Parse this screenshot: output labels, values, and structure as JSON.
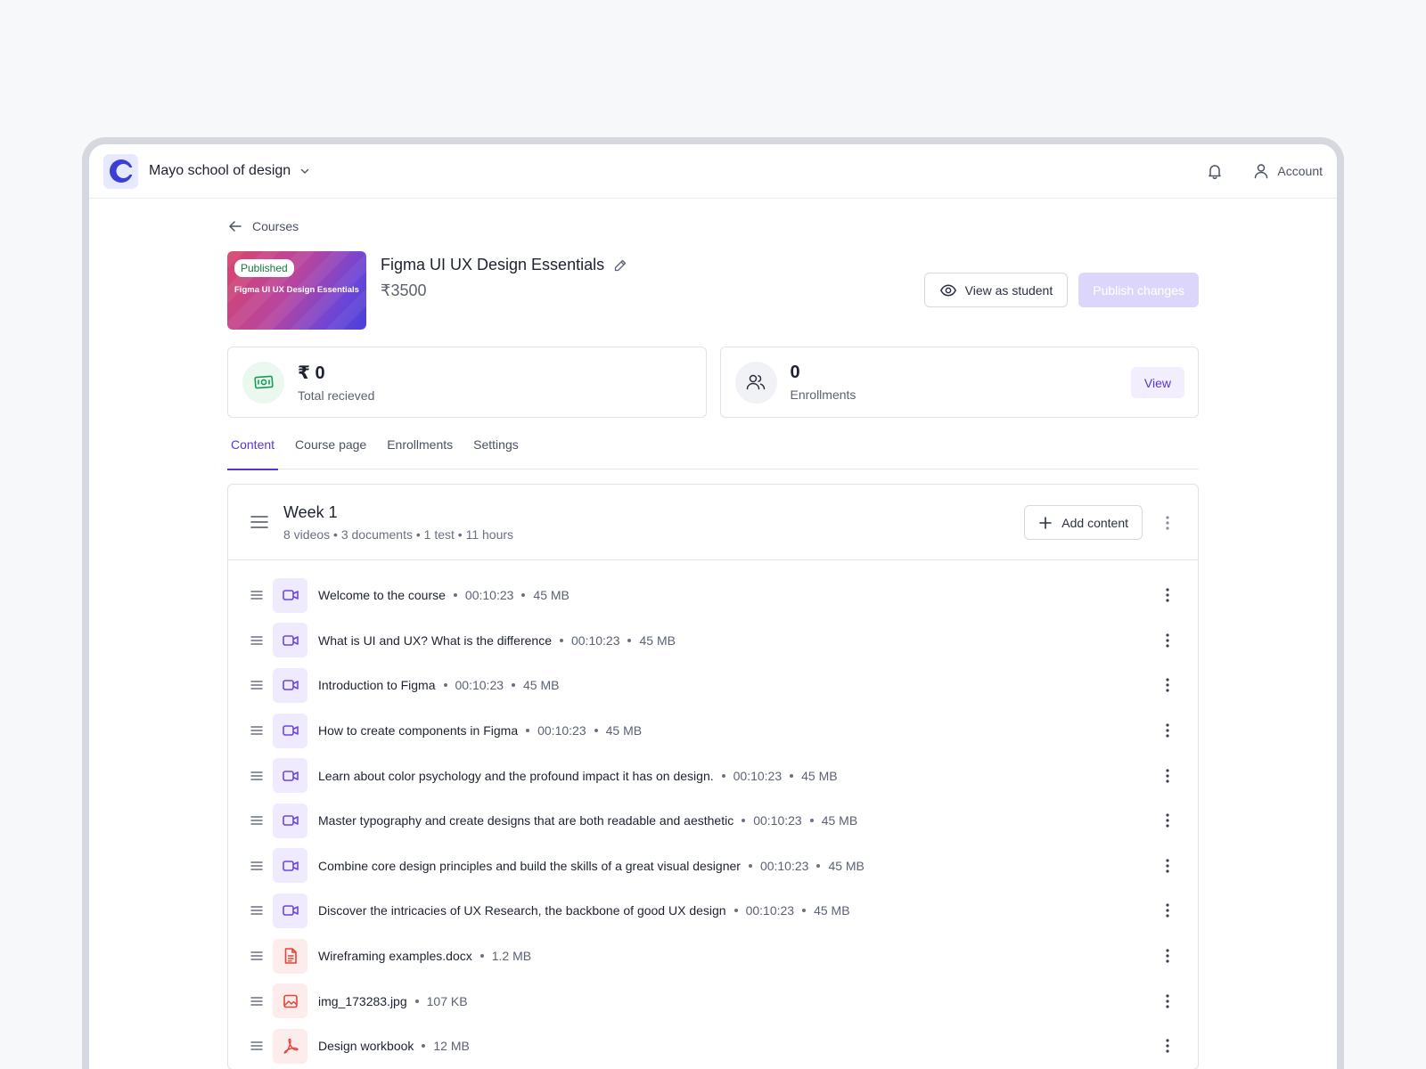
{
  "header": {
    "school_name": "Mayo school of design",
    "account_label": "Account"
  },
  "breadcrumb": {
    "label": "Courses"
  },
  "course": {
    "status_badge": "Published",
    "thumbnail_title": "Figma UI UX Design Essentials",
    "title": "Figma UI UX Design Essentials",
    "price": "₹3500"
  },
  "actions": {
    "view_as_student": "View as student",
    "publish_changes": "Publish changes"
  },
  "stats": {
    "received_value": "₹ 0",
    "received_label": "Total recieved",
    "enrollments_value": "0",
    "enrollments_label": "Enrollments",
    "view_label": "View"
  },
  "tabs": [
    {
      "label": "Content",
      "active": true
    },
    {
      "label": "Course page",
      "active": false
    },
    {
      "label": "Enrollments",
      "active": false
    },
    {
      "label": "Settings",
      "active": false
    }
  ],
  "week": {
    "title": "Week 1",
    "meta": "8 videos • 3 documents • 1 test • 11 hours",
    "add_content_label": "Add content"
  },
  "items": [
    {
      "type": "video",
      "name": "Welcome to the course",
      "duration": "00:10:23",
      "size": "45 MB"
    },
    {
      "type": "video",
      "name": "What is UI and UX? What is the difference",
      "duration": "00:10:23",
      "size": "45 MB"
    },
    {
      "type": "video",
      "name": "Introduction to Figma",
      "duration": "00:10:23",
      "size": "45 MB"
    },
    {
      "type": "video",
      "name": "How to create components in Figma",
      "duration": "00:10:23",
      "size": "45 MB"
    },
    {
      "type": "video",
      "name": "Learn about color psychology and the profound impact it has on design.",
      "duration": "00:10:23",
      "size": "45 MB"
    },
    {
      "type": "video",
      "name": "Master typography and create designs that are both readable and aesthetic",
      "duration": "00:10:23",
      "size": "45 MB"
    },
    {
      "type": "video",
      "name": "Combine core design principles and build the skills of a great visual designer",
      "duration": "00:10:23",
      "size": "45 MB"
    },
    {
      "type": "video",
      "name": "Discover the intricacies of UX Research, the backbone of good UX design",
      "duration": "00:10:23",
      "size": "45 MB"
    },
    {
      "type": "doc",
      "name": "Wireframing examples.docx",
      "size": "1.2 MB"
    },
    {
      "type": "img",
      "name": "img_173283.jpg",
      "size": "107 KB"
    },
    {
      "type": "pdf",
      "name": "Design workbook",
      "size": "12 MB"
    }
  ],
  "colors": {
    "accent": "#5b34d6",
    "published_green": "#137a3d",
    "money_green": "#1a9a55",
    "file_red": "#e0453a"
  }
}
